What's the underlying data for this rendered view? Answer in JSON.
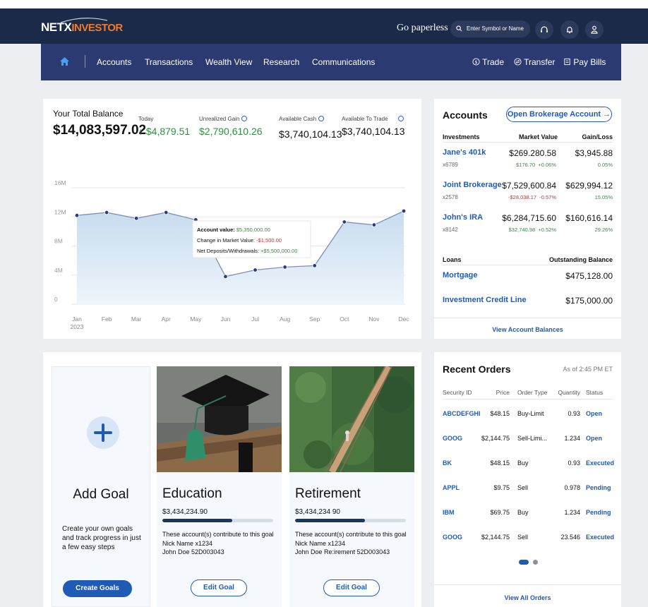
{
  "brand": {
    "logo_part1": "NETX",
    "logo_part2": "INVESTOR"
  },
  "header": {
    "paperless": "Go paperless",
    "search_placeholder": "Enter Symbol or Name"
  },
  "nav": {
    "items": [
      "Accounts",
      "Transactions",
      "Wealth View",
      "Research",
      "Communications"
    ],
    "actions": [
      "Trade",
      "Transfer",
      "Pay Bills"
    ]
  },
  "balance": {
    "title": "Your Total Balance",
    "total": "$14,083,597.02",
    "stats": [
      {
        "label": "Today",
        "value": "↑ $4,879.51"
      },
      {
        "label": "Unrealized Gain",
        "value": "$2,790,610.26"
      },
      {
        "label": "Available Cash",
        "value": "$3,740,104.13"
      },
      {
        "label": "Available To Trade",
        "value": "$3,740,104.13"
      }
    ]
  },
  "chart_data": {
    "type": "area",
    "categories": [
      "Jan",
      "Feb",
      "Mar",
      "Apr",
      "May",
      "Jun",
      "Jul",
      "Aug",
      "Sep",
      "Oct",
      "Nov",
      "Dec"
    ],
    "year_label": "2023",
    "series": [
      {
        "values": [
          12.2,
          12.6,
          11.8,
          12.6,
          11.6,
          3.8,
          4.7,
          5.1,
          5.3,
          11.3,
          10.9,
          12.8
        ]
      }
    ],
    "yticks": [
      "16M",
      "12M",
      "8M",
      "4M",
      "0"
    ],
    "ylim": [
      0,
      16
    ],
    "tooltip": {
      "account_label": "Account value:",
      "account_value": "$5,350,000.00",
      "market_label": "Change in Market Value:",
      "market_value": "-$1,500.00",
      "deposits_label": "Net Deposits/Withdrawals:",
      "deposits_value": "+$5,500,000.00"
    },
    "colors": {
      "line": "#7d90b5",
      "point": "#243d86",
      "fill_top": "#c7dcef",
      "fill_bottom": "#eef5fb"
    }
  },
  "accounts": {
    "title": "Accounts",
    "open_button": "Open Brokerage Account →",
    "investments_header": [
      "Investments",
      "Market Value",
      "Gain/Loss"
    ],
    "investments": [
      {
        "name": "Jane's 401k",
        "number": "x6789",
        "value": "$269.280.58",
        "change": "$176.70",
        "change_pct": "+0.06%",
        "gain": "$3,945.88",
        "gain_pct": "0.05%",
        "direction": "up"
      },
      {
        "name": "Joint Brokerage",
        "number": "x2578",
        "value": "$7,529,600.84",
        "change": "-$28,038.17",
        "change_pct": "-0.57%",
        "gain": "$629,994.12",
        "gain_pct": "15.05%",
        "direction": "down"
      },
      {
        "name": "John's IRA",
        "number": "x8142",
        "value": "$6,284,715.60",
        "change": "$32,740.98",
        "change_pct": "+0.52%",
        "gain": "$160,616.14",
        "gain_pct": "29.26%",
        "direction": "up"
      }
    ],
    "loans_header": [
      "Loans",
      "Outstanding Balance"
    ],
    "loans": [
      {
        "name": "Mortgage",
        "balance": "$475,128.00"
      },
      {
        "name": "Investment Credit Line",
        "balance": "$175,000.00"
      }
    ],
    "view_link": "View Account Balances"
  },
  "goals": {
    "add": {
      "title": "Add Goal",
      "description": "Create your own goals and track progress in just a few easy steps",
      "button": "Create Goals"
    },
    "items": [
      {
        "title": "Education",
        "amount": "$3,434,234.90",
        "progress": 0.63,
        "line1": "These account(s) contribute to this goal",
        "line2": "Nick Name x1234",
        "line3": "John Doe 52D003043",
        "button": "Edit Goal"
      },
      {
        "title": "Retirement",
        "amount": "$3,434,234 90",
        "progress": 0.63,
        "line1": "These account(s) contribute to this goal",
        "line2": "Nick Name x1234",
        "line3": "John Doe Re:irement 52D003043",
        "button": "Edit Goal"
      }
    ]
  },
  "orders": {
    "title": "Recent Orders",
    "as_of": "As of 2:45 PM ET",
    "columns": [
      "Security ID",
      "Price",
      "Order Type",
      "Quantity",
      "Status"
    ],
    "rows": [
      {
        "id": "ABCDEFGHI",
        "price": "$48.15",
        "type": "Buy-Limit",
        "qty": "0.93",
        "status": "Open"
      },
      {
        "id": "GOOG",
        "price": "$2,144.75",
        "type": "Sell-Limi...",
        "qty": "1.234",
        "status": "Open"
      },
      {
        "id": "BK",
        "price": "$48.15",
        "type": "Buy",
        "qty": "0.93",
        "status": "Executed"
      },
      {
        "id": "APPL",
        "price": "$9.75",
        "type": "Sell",
        "qty": "0.978",
        "status": "Pending"
      },
      {
        "id": "IBM",
        "price": "$69.75",
        "type": "Buy",
        "qty": "1.234",
        "status": "Pending"
      },
      {
        "id": "GOOG",
        "price": "$2,144.75",
        "type": "Sell",
        "qty": "23.546",
        "status": "Executed"
      }
    ],
    "view_link": "View All Orders"
  }
}
